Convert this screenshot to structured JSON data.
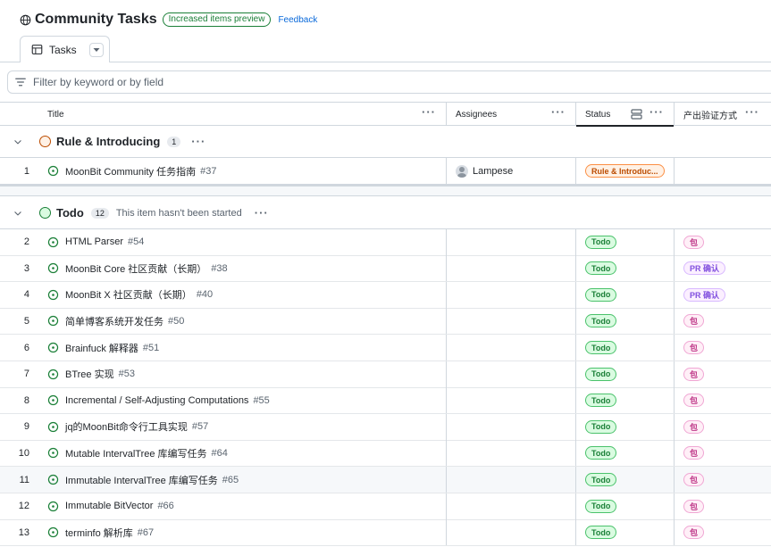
{
  "project": {
    "title": "Community Tasks",
    "badge": "Increased items preview",
    "feedback": "Feedback"
  },
  "view_tab": {
    "label": "Tasks"
  },
  "filter": {
    "placeholder": "Filter by keyword or by field"
  },
  "columns": {
    "title": "Title",
    "assignees": "Assignees",
    "status": "Status",
    "output": "产出验证方式"
  },
  "groups": [
    {
      "name": "Rule & Introducing",
      "count": "1",
      "description": "",
      "color": "#bc4c00",
      "items": [
        {
          "num": "1",
          "title": "MoonBit Community 任务指南",
          "issue": "#37",
          "assignee": "Lampese",
          "status": "Rule & Introduc...",
          "status_kind": "rule",
          "output": "",
          "output_kind": ""
        }
      ]
    },
    {
      "name": "Todo",
      "count": "12",
      "description": "This item hasn't been started",
      "color": "#1a7f37",
      "items": [
        {
          "num": "2",
          "title": "HTML Parser",
          "issue": "#54",
          "assignee": "",
          "status": "Todo",
          "status_kind": "todo",
          "output": "包",
          "output_kind": "bao"
        },
        {
          "num": "3",
          "title": "MoonBit Core 社区贡献（长期）",
          "issue": "#38",
          "assignee": "",
          "status": "Todo",
          "status_kind": "todo",
          "output": "PR 确认",
          "output_kind": "pr"
        },
        {
          "num": "4",
          "title": "MoonBit X 社区贡献（长期）",
          "issue": "#40",
          "assignee": "",
          "status": "Todo",
          "status_kind": "todo",
          "output": "PR 确认",
          "output_kind": "pr"
        },
        {
          "num": "5",
          "title": "简单博客系统开发任务",
          "issue": "#50",
          "assignee": "",
          "status": "Todo",
          "status_kind": "todo",
          "output": "包",
          "output_kind": "bao"
        },
        {
          "num": "6",
          "title": "Brainfuck 解释器",
          "issue": "#51",
          "assignee": "",
          "status": "Todo",
          "status_kind": "todo",
          "output": "包",
          "output_kind": "bao"
        },
        {
          "num": "7",
          "title": "BTree 实现",
          "issue": "#53",
          "assignee": "",
          "status": "Todo",
          "status_kind": "todo",
          "output": "包",
          "output_kind": "bao"
        },
        {
          "num": "8",
          "title": "Incremental / Self-Adjusting Computations",
          "issue": "#55",
          "assignee": "",
          "status": "Todo",
          "status_kind": "todo",
          "output": "包",
          "output_kind": "bao"
        },
        {
          "num": "9",
          "title": "jq的MoonBit命令行工具实现",
          "issue": "#57",
          "assignee": "",
          "status": "Todo",
          "status_kind": "todo",
          "output": "包",
          "output_kind": "bao"
        },
        {
          "num": "10",
          "title": "Mutable IntervalTree 库编写任务",
          "issue": "#64",
          "assignee": "",
          "status": "Todo",
          "status_kind": "todo",
          "output": "包",
          "output_kind": "bao"
        },
        {
          "num": "11",
          "title": "Immutable IntervalTree 库编写任务",
          "issue": "#65",
          "assignee": "",
          "status": "Todo",
          "status_kind": "todo",
          "output": "包",
          "output_kind": "bao"
        },
        {
          "num": "12",
          "title": "Immutable BitVector",
          "issue": "#66",
          "assignee": "",
          "status": "Todo",
          "status_kind": "todo",
          "output": "包",
          "output_kind": "bao"
        },
        {
          "num": "13",
          "title": "terminfo 解析库",
          "issue": "#67",
          "assignee": "",
          "status": "Todo",
          "status_kind": "todo",
          "output": "包",
          "output_kind": "bao"
        }
      ]
    }
  ]
}
